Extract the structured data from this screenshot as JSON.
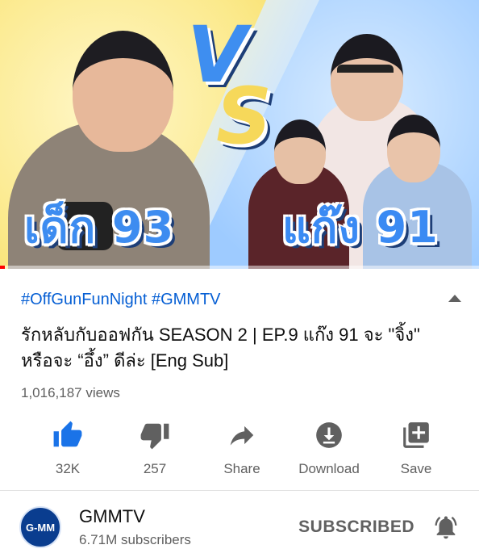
{
  "thumbnail": {
    "left_text": "เด็ก 93",
    "vs_v": "V",
    "vs_s": "S",
    "right_text": "แก๊ง 91",
    "progress": 0.01
  },
  "video": {
    "hashtags": "#OffGunFunNight #GMMTV",
    "title": "รักหลับกับออฟกัน SEASON 2 | EP.9 แก๊ง 91 จะ \"จิ้ง\" หรือจะ “อึ้ง” ดีล่ะ [Eng Sub]",
    "views": "1,016,187 views"
  },
  "actions": [
    {
      "label": "32K",
      "icon": "thumbs-up-icon"
    },
    {
      "label": "257",
      "icon": "thumbs-down-icon"
    },
    {
      "label": "Share",
      "icon": "share-icon"
    },
    {
      "label": "Download",
      "icon": "download-icon"
    },
    {
      "label": "Save",
      "icon": "save-playlist-icon"
    }
  ],
  "channel": {
    "avatar_text": "G-MM",
    "name": "GMMTV",
    "subscribers": "6.71M subscribers",
    "subscribe_state": "SUBSCRIBED"
  },
  "colors": {
    "accent_blue": "#065fd4",
    "like_blue": "#1a73e8",
    "icon_gray": "#606060",
    "progress_red": "#ff0000"
  }
}
